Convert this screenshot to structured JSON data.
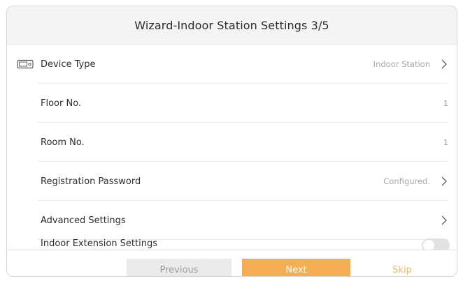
{
  "header": {
    "title": "Wizard-Indoor Station Settings 3/5"
  },
  "settings": {
    "device_type": {
      "label": "Device Type",
      "value": "Indoor Station"
    },
    "floor_no": {
      "label": "Floor No.",
      "value": "1"
    },
    "room_no": {
      "label": "Room No.",
      "value": "1"
    },
    "registration_password": {
      "label": "Registration Password",
      "value": "Configured."
    },
    "advanced_settings": {
      "label": "Advanced Settings"
    },
    "indoor_extension": {
      "label": "Indoor Extension Settings",
      "enabled": false
    }
  },
  "footer": {
    "previous_label": "Previous",
    "next_label": "Next",
    "skip_label": "Skip"
  },
  "colors": {
    "accent": "#f5ae52",
    "skip_text": "#f3b96b",
    "disabled_button": "#ebebeb",
    "title_bar": "#f4f4f4"
  },
  "icons": [
    "device-icon",
    "chevron-right-icon"
  ]
}
